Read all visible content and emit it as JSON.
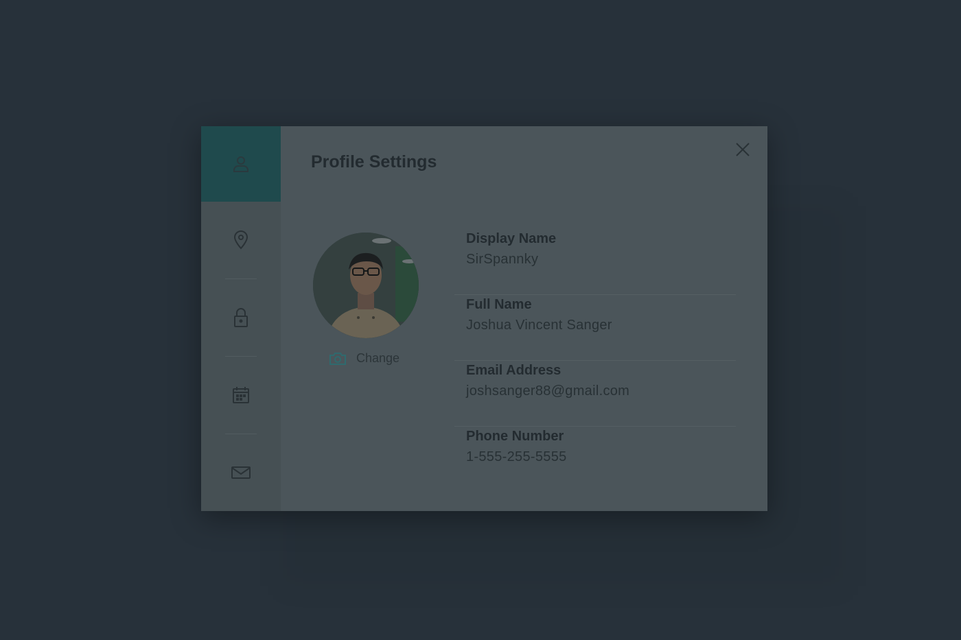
{
  "modal": {
    "title": "Profile Settings"
  },
  "sidebar": {
    "items": [
      {
        "icon": "user-icon",
        "active": true
      },
      {
        "icon": "location-pin-icon",
        "active": false
      },
      {
        "icon": "lock-icon",
        "active": false
      },
      {
        "icon": "calendar-icon",
        "active": false
      },
      {
        "icon": "mail-icon",
        "active": false
      }
    ]
  },
  "avatar": {
    "change_label": "Change"
  },
  "fields": [
    {
      "label": "Display Name",
      "value": "SirSpannky"
    },
    {
      "label": "Full Name",
      "value": "Joshua Vincent Sanger"
    },
    {
      "label": "Email Address",
      "value": "joshsanger88@gmail.com"
    },
    {
      "label": "Phone Number",
      "value": "1-555-255-5555"
    }
  ],
  "colors": {
    "page_background": "#27313a",
    "modal_background": "#4b555a",
    "sidebar_background": "#465054",
    "accent": "#1f4a4d",
    "accent_icon": "#2f6a6e"
  }
}
